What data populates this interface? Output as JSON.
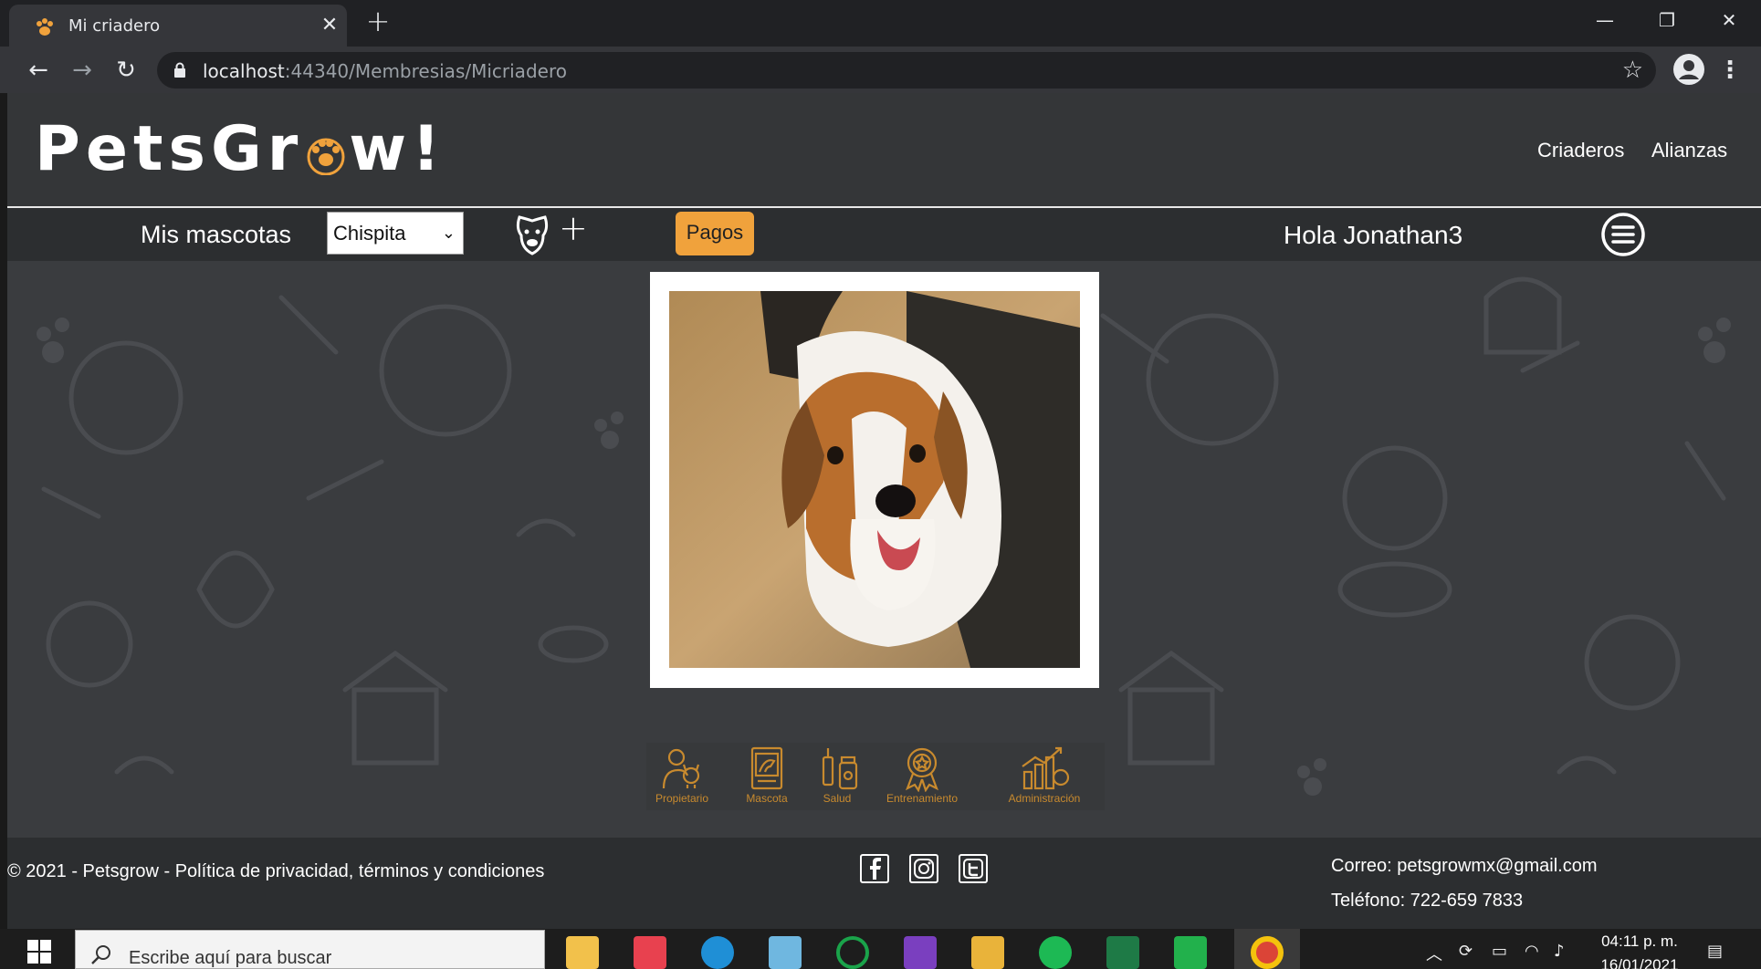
{
  "browser": {
    "tab_title": "Mi criadero",
    "url_host": "localhost",
    "url_rest": ":44340/Membresias/Micriadero"
  },
  "site": {
    "logo_prefix": "PetsGr",
    "logo_suffix": "w!",
    "nav": [
      "Criaderos",
      "Alianzas"
    ],
    "mis_mascotas": "Mis mascotas",
    "selected_pet": "Chispita",
    "pagos": "Pagos",
    "greeting": "Hola Jonathan3",
    "accent": "#f0a23c"
  },
  "sections": [
    {
      "label": "Propietario",
      "icon": "owner-with-dog-icon"
    },
    {
      "label": "Mascota",
      "icon": "pet-document-icon"
    },
    {
      "label": "Salud",
      "icon": "medicine-icon"
    },
    {
      "label": "Entrenamiento",
      "icon": "award-badge-icon"
    },
    {
      "label": "Administración",
      "icon": "stats-chart-icon"
    }
  ],
  "footer": {
    "copyright": "© 2021 - Petsgrow - Política de privacidad, términos y condiciones",
    "email": "Correo: petsgrowmx@gmail.com",
    "phone": "Teléfono: 722-659 7833"
  },
  "taskbar": {
    "search_placeholder": "Escribe aquí para buscar",
    "time": "04:11 p. m.",
    "date": "16/01/2021"
  }
}
